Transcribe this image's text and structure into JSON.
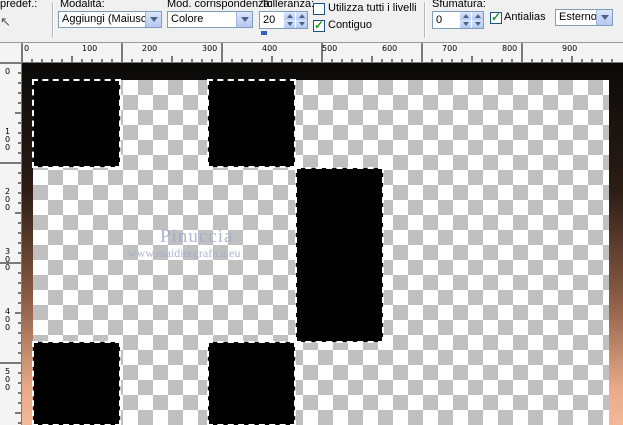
{
  "toolbar": {
    "preset_label": "predef.:",
    "modality": {
      "label": "Modalità:",
      "value": "Aggiungi (Maiusc)"
    },
    "match_mode": {
      "label": "Mod. corrispondenza:",
      "value": "Colore"
    },
    "tolerance": {
      "label": "Tolleranza:",
      "value": "20"
    },
    "use_all_layers": {
      "label": "Utilizza tutti i livelli",
      "checked": false
    },
    "contiguous": {
      "label": "Contiguo",
      "checked": true
    },
    "feather": {
      "label": "Sfumatura:",
      "value": "0"
    },
    "antialias": {
      "label": "Antialias",
      "checked": true
    },
    "antialias_mode": {
      "value": "Esterno"
    }
  },
  "ruler_top": {
    "ticks": [
      "0",
      "100",
      "200",
      "300",
      "400",
      "500",
      "600",
      "700",
      "800",
      "900"
    ]
  },
  "ruler_left": {
    "ticks": [
      "0",
      "100",
      "200",
      "300",
      "400",
      "500"
    ]
  },
  "canvas": {
    "selected_squares": 7,
    "watermark_title": "Pinuccia",
    "watermark_url": "www.maidiregrafica.eu"
  },
  "colors": {
    "selection": "#000000",
    "checker": "#c0c0c0",
    "background_top": "#0a0a0a",
    "background_bottom": "#f4b898"
  }
}
